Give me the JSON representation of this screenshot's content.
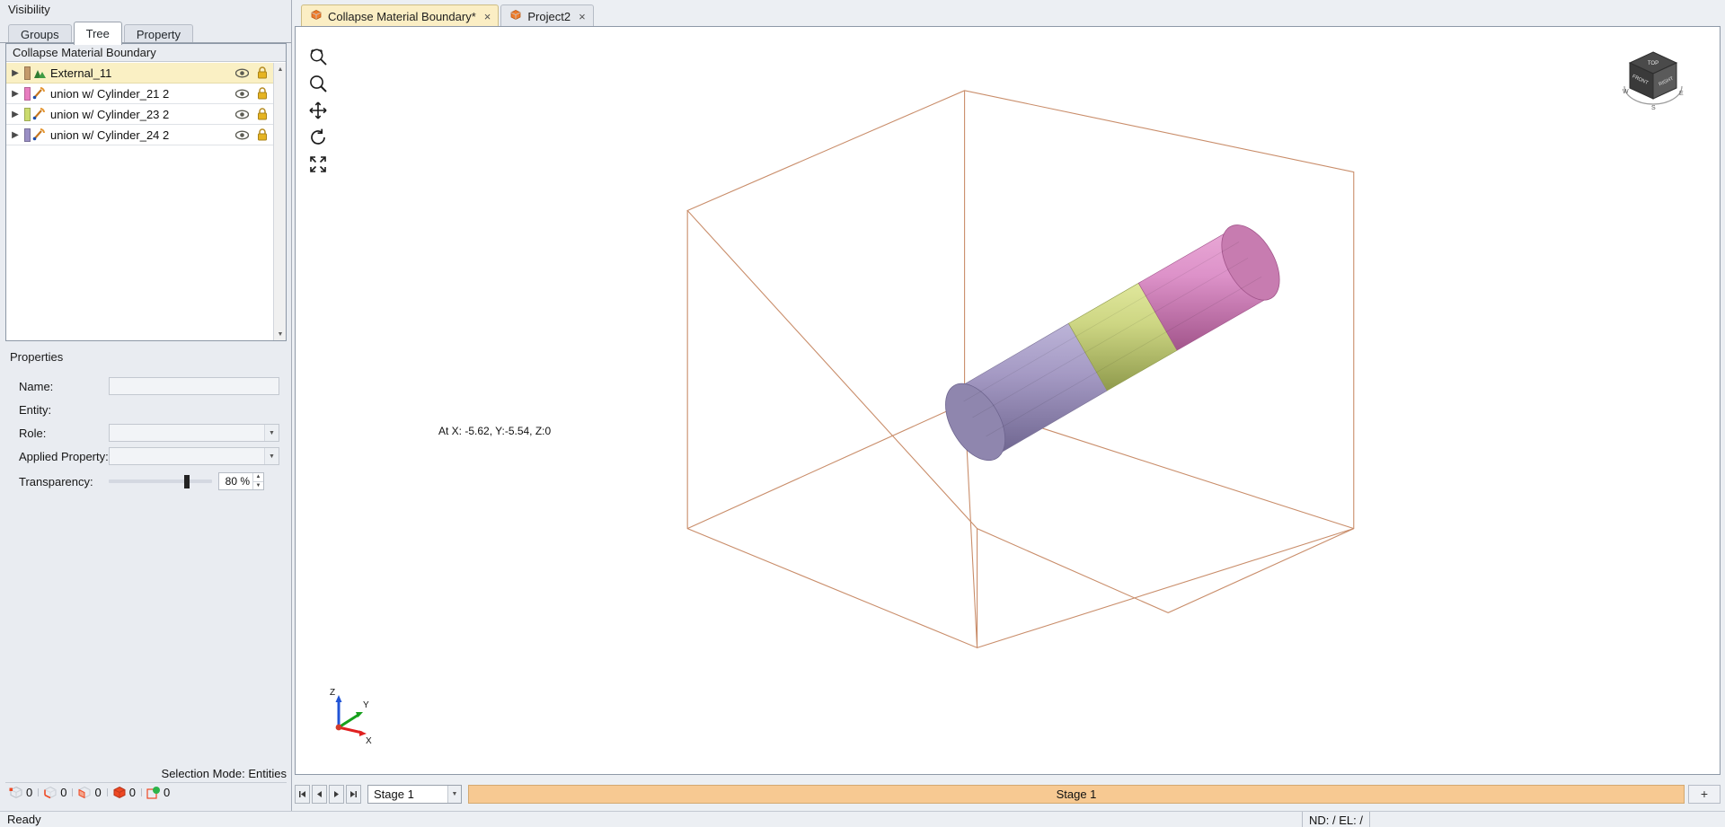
{
  "left_panel": {
    "title": "Visibility",
    "tabs": [
      {
        "label": "Groups",
        "active": false
      },
      {
        "label": "Tree",
        "active": true
      },
      {
        "label": "Property",
        "active": false
      }
    ],
    "tree_header": "Collapse Material Boundary",
    "tree_rows": [
      {
        "label": "External_11",
        "swatch": "#c39a6b",
        "icon": "mountain-icon",
        "selected": true,
        "eye": "eye-icon",
        "lock": "lock-icon"
      },
      {
        "label": "union w/ Cylinder_21 2",
        "swatch": "#e87ec0",
        "icon": "pick-icon",
        "selected": false,
        "eye": "eye-icon",
        "lock": "lock-icon"
      },
      {
        "label": "union w/ Cylinder_23 2",
        "swatch": "#cbdb6e",
        "icon": "pick-icon",
        "selected": false,
        "eye": "eye-icon",
        "lock": "lock-icon"
      },
      {
        "label": "union w/ Cylinder_24 2",
        "swatch": "#9a8fc4",
        "icon": "pick-icon",
        "selected": false,
        "eye": "eye-icon",
        "lock": "lock-icon"
      }
    ],
    "properties": {
      "title": "Properties",
      "fields": [
        {
          "label": "Name:",
          "value": "",
          "kind": "text"
        },
        {
          "label": "Entity:",
          "value": "",
          "kind": "plain"
        },
        {
          "label": "Role:",
          "value": "",
          "kind": "combo"
        },
        {
          "label": "Applied Property:",
          "value": "",
          "kind": "combo"
        }
      ],
      "transparency": {
        "label": "Transparency:",
        "value": "80 %",
        "percent": 80
      }
    },
    "selection_mode": "Selection Mode: Entities",
    "counters": [
      {
        "icon": "vertex-count-icon",
        "value": "0"
      },
      {
        "icon": "edge-count-icon",
        "value": "0"
      },
      {
        "icon": "face-count-icon",
        "value": "0"
      },
      {
        "icon": "solid-count-icon",
        "value": "0"
      },
      {
        "icon": "entity-count-icon",
        "value": "0"
      }
    ]
  },
  "doc_tabs": [
    {
      "label": "Collapse Material Boundary*",
      "active": true,
      "close": "×",
      "icon": "model-icon"
    },
    {
      "label": "Project2",
      "active": false,
      "close": "×",
      "icon": "model-icon"
    }
  ],
  "viewport": {
    "tools": [
      {
        "name": "zoom-window-icon"
      },
      {
        "name": "zoom-icon"
      },
      {
        "name": "pan-icon"
      },
      {
        "name": "rotate-icon"
      },
      {
        "name": "zoom-all-icon"
      }
    ],
    "coordinate_readout": "At X: -5.62, Y:-5.54, Z:0",
    "viewcube": {
      "top": "TOP",
      "front": "FRONT",
      "right": "RIGHT",
      "compass_w": "W",
      "compass_s": "S",
      "compass_e": "E"
    },
    "axis_triad": {
      "x": "X",
      "y": "Y",
      "z": "Z"
    },
    "model_colors": {
      "pink": "#dd92c9",
      "yellow": "#cdd683",
      "purple": "#a59ac4",
      "box_edge": "#c98d6a"
    }
  },
  "stage_bar": {
    "nav": [
      {
        "name": "first-stage-button",
        "glyph": "◀│"
      },
      {
        "name": "prev-stage-button",
        "glyph": "◀"
      },
      {
        "name": "next-stage-button",
        "glyph": "▶"
      },
      {
        "name": "last-stage-button",
        "glyph": "│▶"
      }
    ],
    "stage_select": "Stage 1",
    "stage_band": "Stage 1",
    "add_button": "+"
  },
  "status_bar": {
    "ready": "Ready",
    "nd_el": "ND: /  EL: /"
  },
  "colors": {
    "accent_tab": "#fbeec4",
    "selection_row": "#faf0c4",
    "stage_band": "#f7c992",
    "panel_bg": "#e9ecf1"
  }
}
